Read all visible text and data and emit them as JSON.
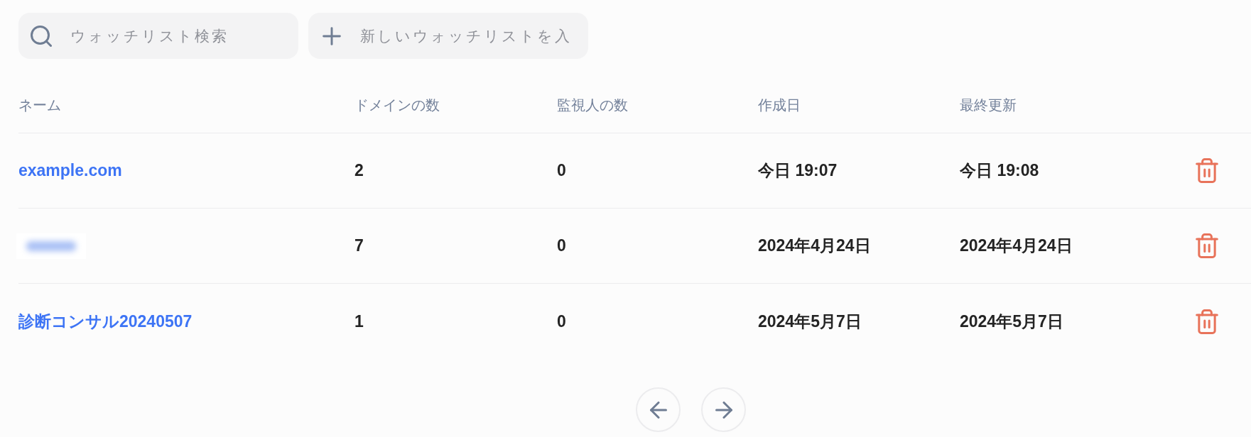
{
  "search": {
    "placeholder": "ウォッチリスト検索"
  },
  "new_watchlist": {
    "placeholder": "新しいウォッチリストを入"
  },
  "table": {
    "columns": [
      "ネーム",
      "ドメインの数",
      "監視人の数",
      "作成日",
      "最終更新"
    ],
    "rows": [
      {
        "kind": "link",
        "name": "example.com",
        "domains": "2",
        "watchers": "0",
        "created": "今日 19:07",
        "updated": "今日 19:08"
      },
      {
        "kind": "redacted",
        "domains": "7",
        "watchers": "0",
        "created": "2024年4月24日",
        "updated": "2024年4月24日"
      },
      {
        "kind": "link",
        "name": "診断コンサル20240507",
        "domains": "1",
        "watchers": "0",
        "created": "2024年5月7日",
        "updated": "2024年5月7日"
      }
    ]
  }
}
